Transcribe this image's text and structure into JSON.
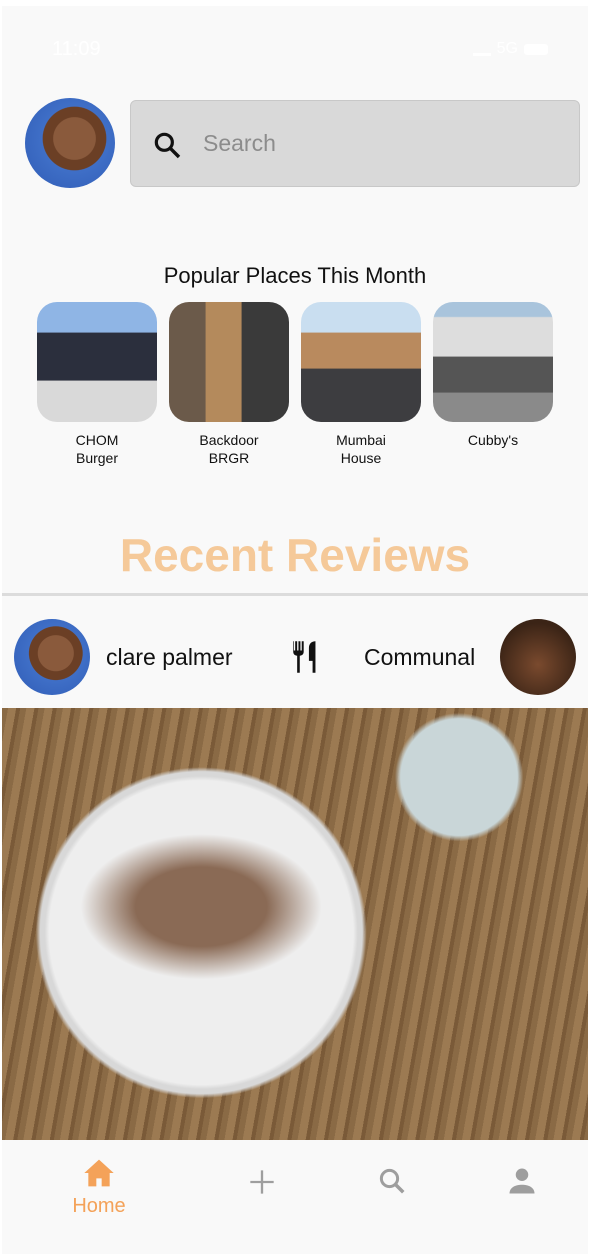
{
  "status_bar": {
    "time": "11:09",
    "network": "5G"
  },
  "search": {
    "placeholder": "Search"
  },
  "popular": {
    "title": "Popular Places This Month",
    "places": [
      {
        "name": "CHOM Burger",
        "line1": "CHOM",
        "line2": "Burger"
      },
      {
        "name": "Backdoor BRGR",
        "line1": "Backdoor",
        "line2": "BRGR"
      },
      {
        "name": "Mumbai House",
        "line1": "Mumbai",
        "line2": "House"
      },
      {
        "name": "Cubby's",
        "line1": "Cubby's",
        "line2": ""
      }
    ]
  },
  "recent": {
    "title": "Recent Reviews"
  },
  "review": {
    "user": "clare palmer",
    "restaurant": "Communal",
    "icon": "fork-knife-icon"
  },
  "nav": {
    "items": [
      {
        "label": "Home",
        "icon": "home-icon",
        "active": true
      },
      {
        "label": "",
        "icon": "plus-icon"
      },
      {
        "label": "",
        "icon": "search-icon"
      },
      {
        "label": "",
        "icon": "person-icon"
      }
    ]
  },
  "colors": {
    "accent": "#f4a259",
    "recent_title": "#f5c999",
    "inactive": "#9e9e9e",
    "search_bg": "#d9d9d9"
  }
}
